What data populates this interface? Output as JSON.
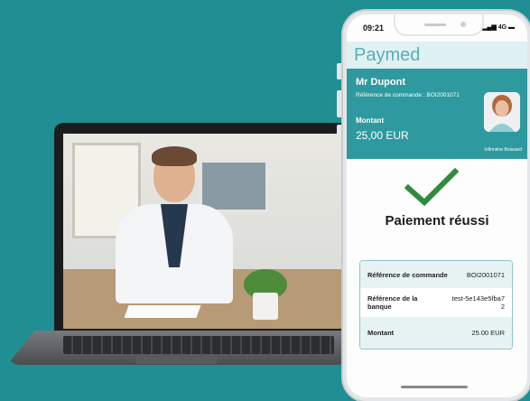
{
  "phone": {
    "status_time": "09:21",
    "status_right": "4G",
    "logo": "Paymed",
    "patient_name": "Mr Dupont",
    "order_ref_line": "Référence de commande : BOI2001071",
    "amount_label": "Montant",
    "amount_value": "25,00 EUR",
    "nurse_label": "Infirmière Boissard",
    "success_title": "Paiement réussi",
    "summary": [
      {
        "label": "Référence de commande",
        "value": "BOI2001071"
      },
      {
        "label": "Référence de la banque",
        "value": "test-5e143e5fba72"
      },
      {
        "label": "Montant",
        "value": "25.00 EUR"
      }
    ]
  },
  "colors": {
    "background": "#1f8f94",
    "panel": "#2e9a9f",
    "success": "#2e8b3f"
  }
}
